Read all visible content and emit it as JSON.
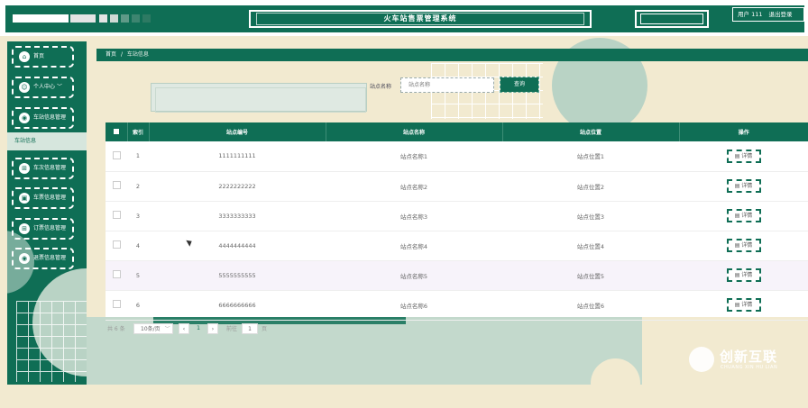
{
  "header": {
    "title": "火车站售票管理系统",
    "user_text": "用户 111",
    "logout_label": "退出登录"
  },
  "sidebar": {
    "items": [
      {
        "label": "首页",
        "icon": "home-icon"
      },
      {
        "label": "个人中心",
        "icon": "user-icon"
      },
      {
        "label": "车站信息管理",
        "icon": "location-icon"
      },
      {
        "label": "车次信息管理",
        "icon": "train-icon"
      },
      {
        "label": "车票信息管理",
        "icon": "ticket-icon"
      },
      {
        "label": "订票信息管理",
        "icon": "order-icon"
      },
      {
        "label": "退票信息管理",
        "icon": "refund-icon"
      }
    ],
    "sub_item": "车站信息",
    "chevron": "﹀"
  },
  "breadcrumb": {
    "home": "首页",
    "separator": "/",
    "current": "车站信息"
  },
  "search": {
    "label": "站点名称",
    "placeholder": "站点名称",
    "button_label": "查询"
  },
  "table": {
    "columns": [
      "索引",
      "站点编号",
      "站点名称",
      "站点位置",
      "操作"
    ],
    "rows": [
      {
        "index": "1",
        "number": "1111111111",
        "name": "站点名称1",
        "location": "站点位置1",
        "action": "详情"
      },
      {
        "index": "2",
        "number": "2222222222",
        "name": "站点名称2",
        "location": "站点位置2",
        "action": "详情"
      },
      {
        "index": "3",
        "number": "3333333333",
        "name": "站点名称3",
        "location": "站点位置3",
        "action": "详情"
      },
      {
        "index": "4",
        "number": "4444444444",
        "name": "站点名称4",
        "location": "站点位置4",
        "action": "详情"
      },
      {
        "index": "5",
        "number": "5555555555",
        "name": "站点名称5",
        "location": "站点位置5",
        "action": "详情"
      },
      {
        "index": "6",
        "number": "6666666666",
        "name": "站点名称6",
        "location": "站点位置6",
        "action": "详情"
      }
    ]
  },
  "pagination": {
    "total": "共 6 条",
    "page_size": "10条/页",
    "current_page": "1",
    "goto_label": "前往",
    "goto_value": "1",
    "page_unit": "页"
  },
  "watermark": {
    "text": "创新互联",
    "sub": "CHUANG XIN HU LIAN"
  },
  "colors": {
    "primary": "#0f6e55",
    "background": "#f2ead0",
    "accent_light": "#b9d3c5"
  }
}
